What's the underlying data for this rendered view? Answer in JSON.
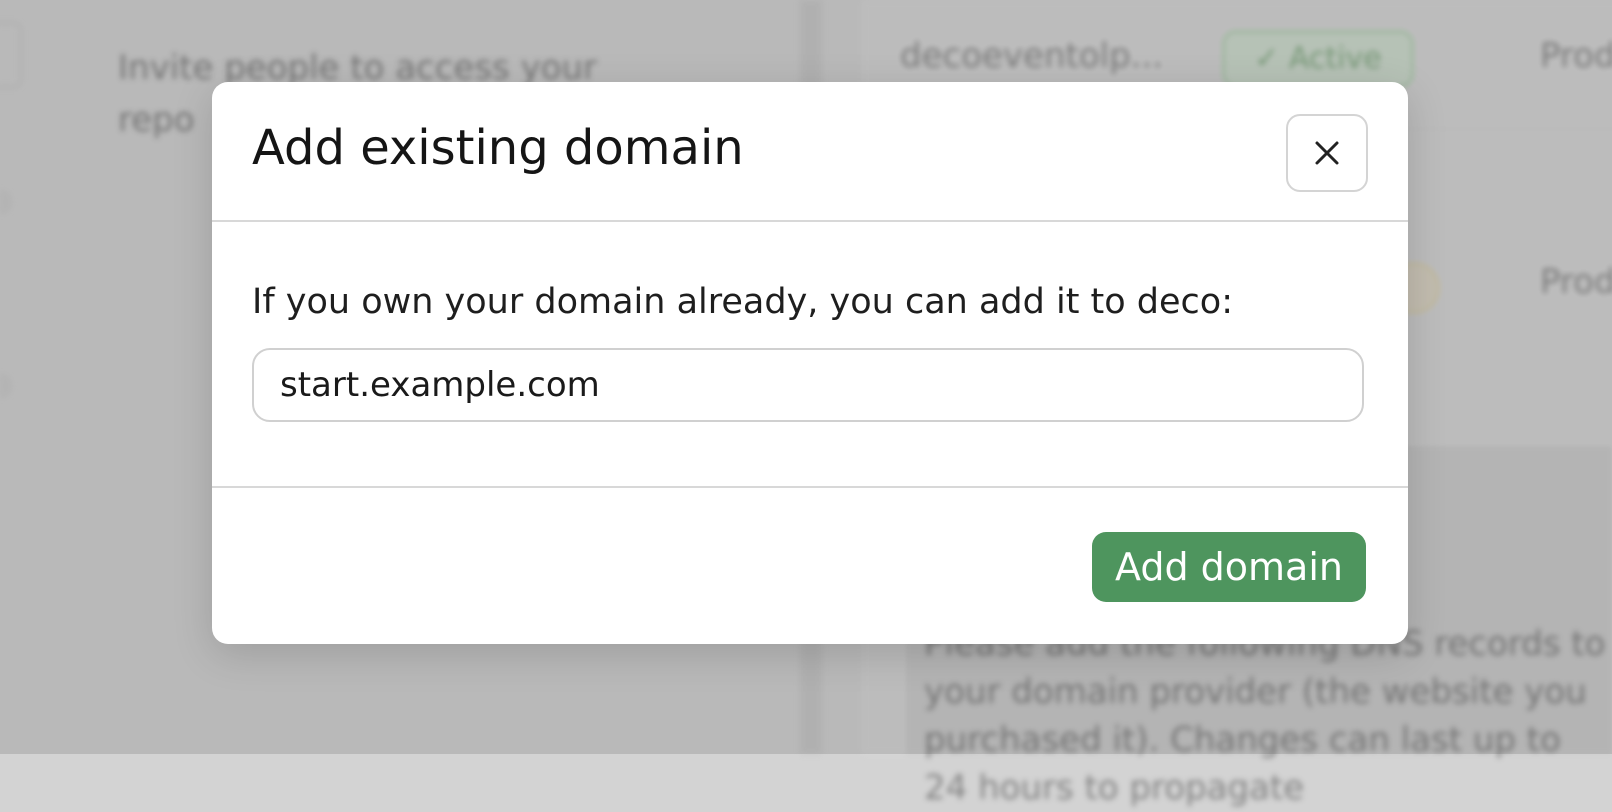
{
  "background": {
    "left_text": "Invite people to access your repo",
    "row_name": "decoeventolp...",
    "badge": "✓ Active",
    "env_label": "Prod",
    "info_text": "Please add the following DNS records to your domain provider (the website you purchased it). Changes can last up to 24 hours to propagate"
  },
  "dialog": {
    "title": "Add existing domain",
    "close_icon": "close-icon",
    "prompt": "If you own your domain already, you can add it to deco:",
    "input_value": "start.example.com",
    "submit_label": "Add domain"
  },
  "colors": {
    "accent": "#4e955e",
    "badge_bg": "#cfe6cf"
  }
}
